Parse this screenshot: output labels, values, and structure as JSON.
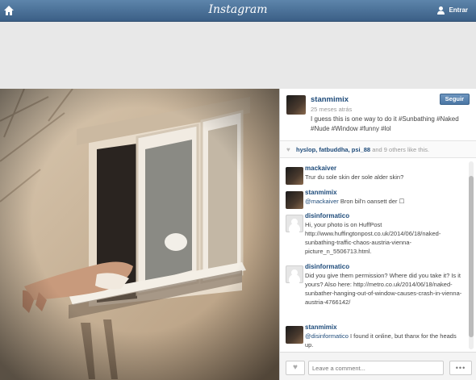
{
  "header": {
    "logo": "Instagram",
    "login_label": "Entrar"
  },
  "post": {
    "username": "stanmimix",
    "time_ago": "25 meses atrás",
    "follow_label": "Seguir",
    "caption": "I guess this is one way to do it #Sunbathing #Naked #Nude #Window #funny #lol",
    "likes": {
      "names": "hyslop, fatbuddha, psi_88",
      "others": " and 9 others like this."
    }
  },
  "comments": [
    {
      "user": "mackaiver",
      "text": "Trur du sole skin der sole alder skin?",
      "mention": ""
    },
    {
      "user": "stanmimix",
      "mention": "@mackaiver",
      "text": " Bron bil'n oansett der ☐"
    },
    {
      "user": "disinformatico",
      "text": "Hi, your photo is on HuffPost http://www.huffingtonpost.co.uk/2014/06/18/naked-sunbathing-traffic-chaos-austria-vienna-picture_n_5506713.html.",
      "mention": ""
    },
    {
      "user": "disinformatico",
      "text": "Did you give them permission? Where did you take it? Is it yours? Also here: http://metro.co.uk/2014/06/18/naked-sunbather-hanging-out-of-window-causes-crash-in-vienna-austria-4766142/",
      "mention": ""
    },
    {
      "user": "stanmimix",
      "mention": "@disinformatico",
      "text": " I found it online, but thanx for the heads up."
    }
  ],
  "footer": {
    "placeholder": "Leave a comment...",
    "more_label": "•••"
  },
  "icons": {
    "home": "home-icon",
    "user": "user-icon",
    "heart": "heart-icon"
  }
}
